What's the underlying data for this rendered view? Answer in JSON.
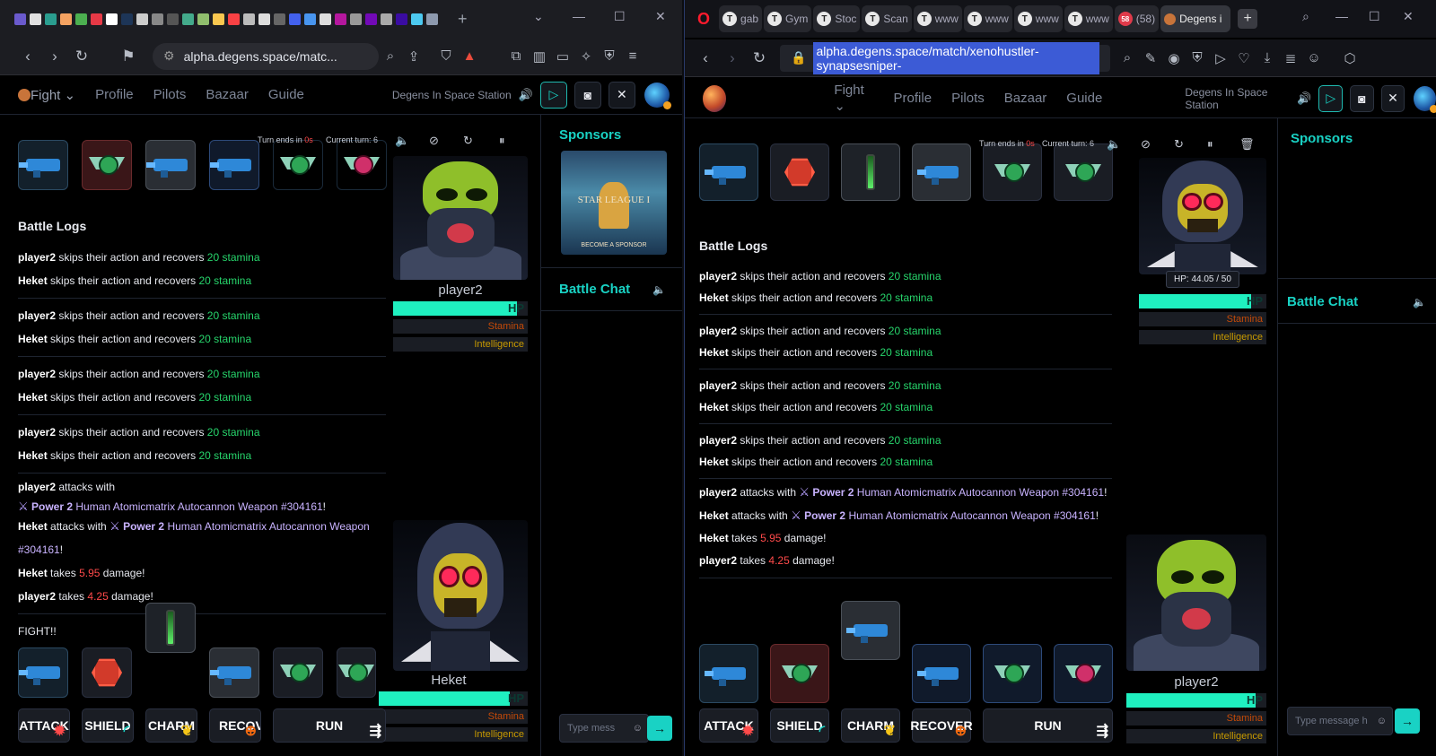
{
  "left": {
    "url": "alpha.degens.space/matc...",
    "nav": {
      "fight": "Fight",
      "profile": "Profile",
      "pilots": "Pilots",
      "bazaar": "Bazaar",
      "guide": "Guide",
      "station": "Degens In Space Station"
    },
    "turn_ends": "Turn ends in",
    "turn_ends_value": "0s",
    "current_turn": "Current turn: 6",
    "battle_logs_title": "Battle Logs",
    "log": {
      "skip_text": "skips their action and recovers",
      "stamina": "20 stamina",
      "p2": "player2",
      "hk": "Heket",
      "attacks_with": "attacks with",
      "weapon_power": "Power 2",
      "weapon_name": "Human Atomicmatrix Autocannon Weapon #304161",
      "bang": "!",
      "takes": "takes",
      "damage": "damage!",
      "heket_dmg": "5.95",
      "p2_dmg": "4.25",
      "fight": "FIGHT!!"
    },
    "top_fighter": {
      "name": "player2",
      "hp": 0.92,
      "stamina": 0.0,
      "intelligence": 0.0
    },
    "bottom_fighter": {
      "name": "Heket",
      "hp": 0.88,
      "stamina": 0.0,
      "intelligence": 0.0
    },
    "bars": {
      "hp": "HP",
      "stamina": "Stamina",
      "intelligence": "Intelligence"
    },
    "actions": [
      "ATTACK",
      "SHIELD",
      "CHARM",
      "RECOVER",
      "RUN"
    ],
    "sponsors": "Sponsors",
    "sponsor_img_title": "STAR LEAGUE I",
    "sponsor_img_sub": "BECOME A SPONSOR",
    "battle_chat": "Battle Chat",
    "chat_placeholder": "Type mess"
  },
  "right": {
    "url": "alpha.degens.space/match/xenohustler-synapsesniper-",
    "tabs": [
      "gab",
      "Gym",
      "Stoc",
      "Scan",
      "www",
      "www",
      "www",
      "www",
      "(58)",
      "Degens i"
    ],
    "notif_count": "58",
    "nav": {
      "fight": "Fight",
      "profile": "Profile",
      "pilots": "Pilots",
      "bazaar": "Bazaar",
      "guide": "Guide",
      "station": "Degens In Space Station"
    },
    "turn_ends": "Turn ends in",
    "turn_ends_value": "0s",
    "current_turn": "Current turn: 6",
    "tooltip": "HP: 44.05 / 50",
    "battle_logs_title": "Battle Logs",
    "top_fighter": {
      "hp": 0.88
    },
    "bottom_fighter": {
      "name": "player2",
      "hp": 0.92
    },
    "sponsors": "Sponsors",
    "battle_chat": "Battle Chat",
    "chat_placeholder": "Type message h"
  },
  "colors": {
    "accent": "#19d2c4",
    "hp": "#1ff0c0",
    "stamina": "#f26a10",
    "intelligence": "#f5c518",
    "stamina_text": "#27d66c",
    "damage_text": "#ff4a4a"
  }
}
